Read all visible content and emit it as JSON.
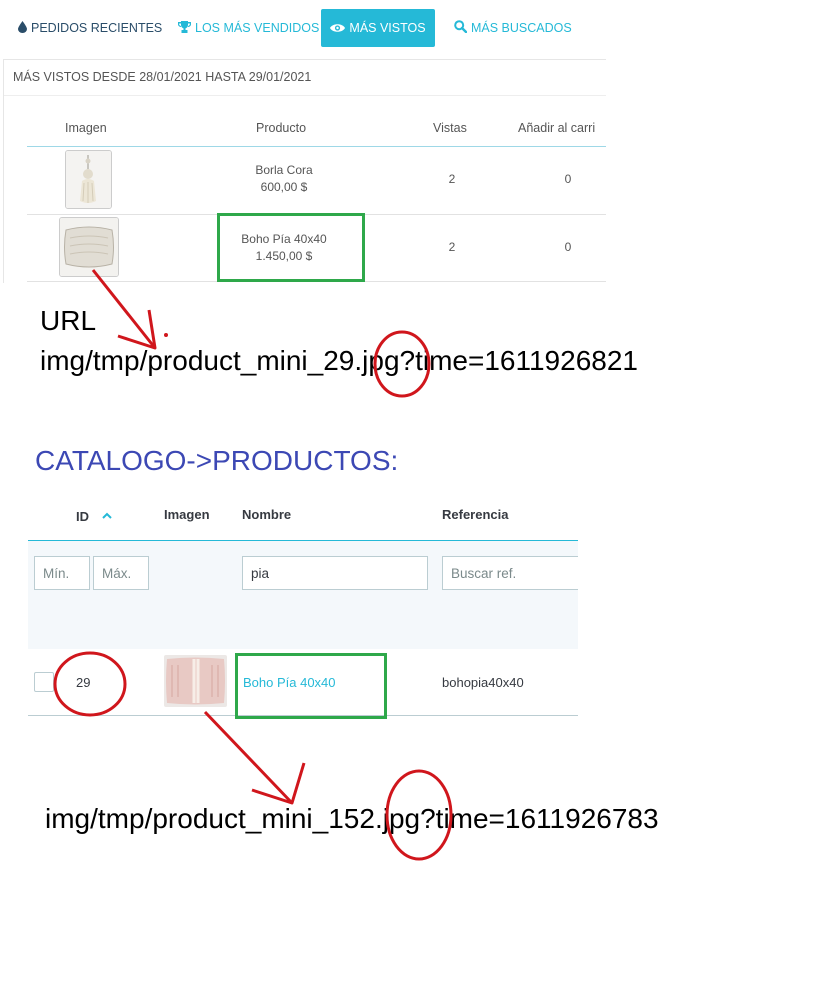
{
  "tabs": [
    {
      "label": "PEDIDOS RECIENTES",
      "icon": "drop-icon"
    },
    {
      "label": "LOS MÁS VENDIDOS",
      "icon": "trophy-icon"
    },
    {
      "label": "MÁS VISTOS",
      "icon": "eye-icon",
      "active": true
    },
    {
      "label": "MÁS BUSCADOS",
      "icon": "search-icon"
    }
  ],
  "most_viewed": {
    "title": "MÁS VISTOS DESDE 28/01/2021 HASTA 29/01/2021",
    "columns": [
      "Imagen",
      "Producto",
      "Vistas",
      "Añadir al carri"
    ],
    "rows": [
      {
        "name": "Borla Cora",
        "price": "600,00 $",
        "views": "2",
        "added": "0"
      },
      {
        "name": "Boho Pía 40x40",
        "price": "1.450,00 $",
        "views": "2",
        "added": "0"
      }
    ]
  },
  "annotation_1": {
    "line1": "URL",
    "line2": "img/tmp/product_mini_29.jpg?time=1611926821"
  },
  "catalog": {
    "heading": "CATALOGO->PRODUCTOS:",
    "columns": {
      "id": "ID",
      "image": "Imagen",
      "name": "Nombre",
      "reference": "Referencia"
    },
    "filters": {
      "min_placeholder": "Mín.",
      "max_placeholder": "Máx.",
      "name_value": "pia",
      "ref_placeholder": "Buscar ref."
    },
    "rows": [
      {
        "id": "29",
        "name": "Boho Pía 40x40",
        "reference": "bohopia40x40"
      }
    ]
  },
  "annotation_2": {
    "line": "img/tmp/product_mini_152.jpg?time=1611926783"
  },
  "colors": {
    "accent": "#25b9d7",
    "highlight_box": "#2ea84a",
    "annotation_red": "#d0161c",
    "heading_blue": "#3c48b4"
  }
}
